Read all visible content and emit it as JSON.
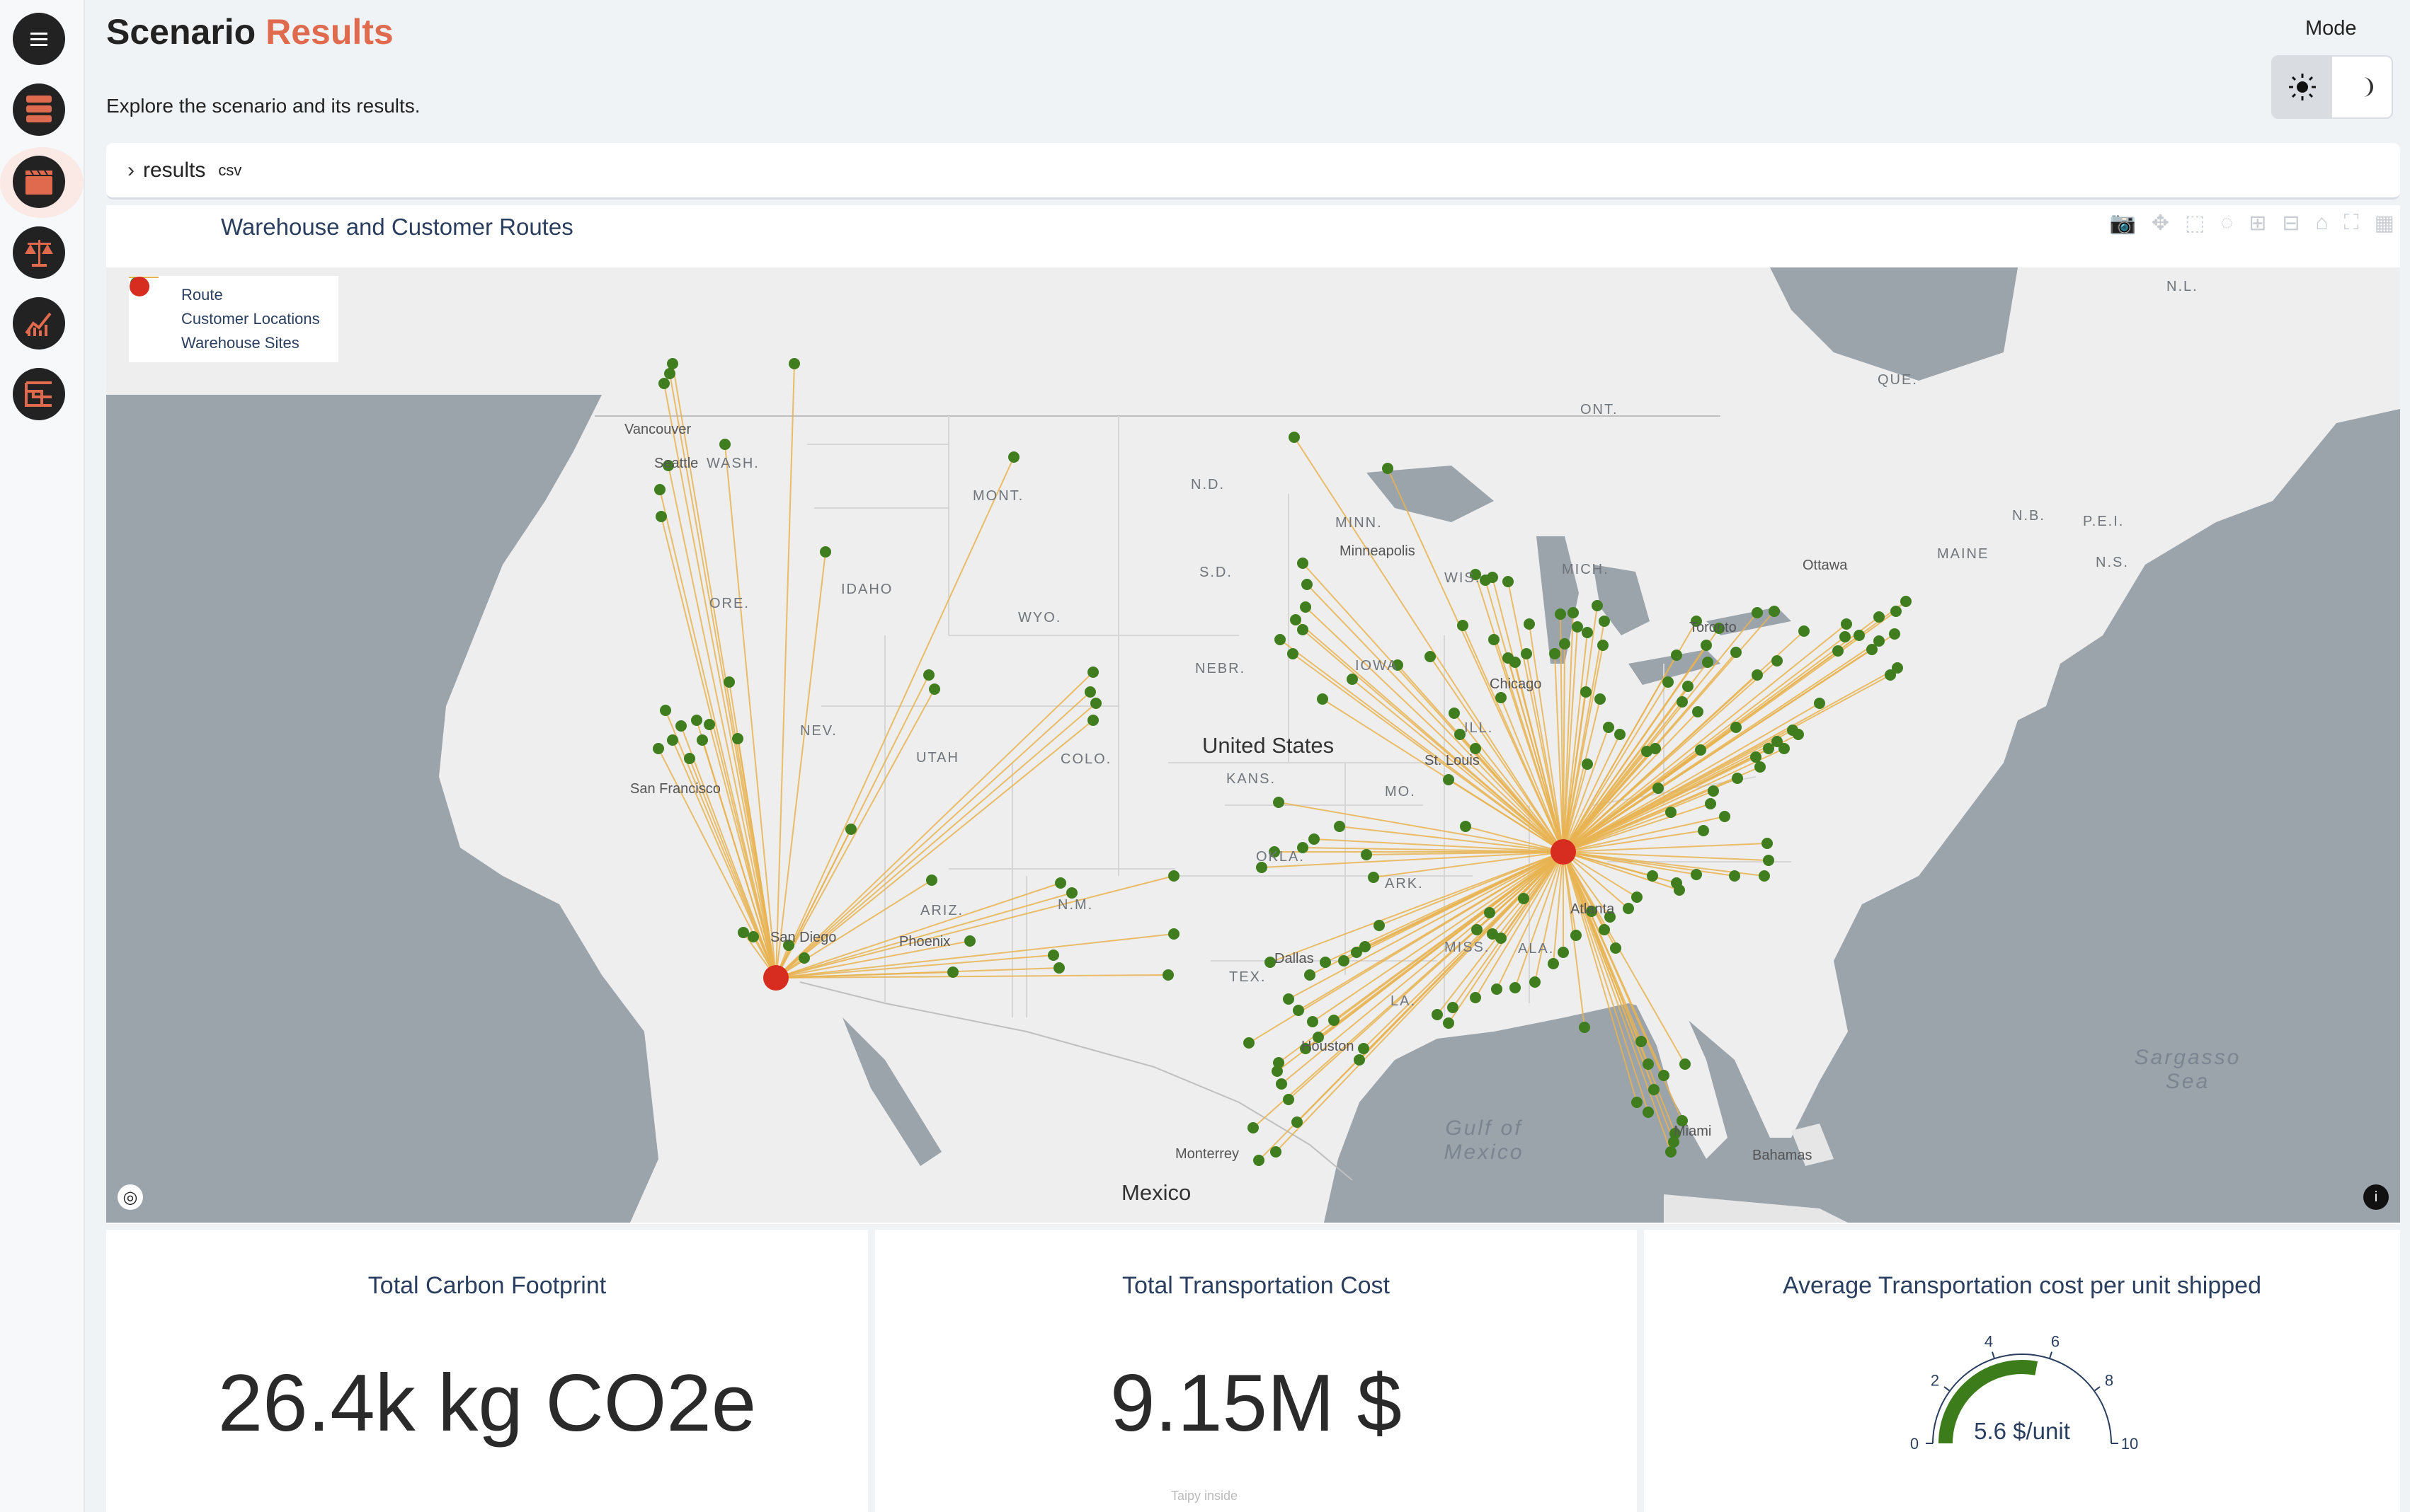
{
  "header": {
    "title_main": "Scenario",
    "title_accent": "Results",
    "subtitle": "Explore the scenario and its results.",
    "mode_label": "Mode"
  },
  "sidebar": {
    "items": [
      {
        "name": "menu-icon"
      },
      {
        "name": "data-stack-icon"
      },
      {
        "name": "scenario-clapper-icon"
      },
      {
        "name": "scales-icon"
      },
      {
        "name": "chart-icon"
      },
      {
        "name": "table-icon"
      }
    ]
  },
  "results_section": {
    "label": "results",
    "badge": "csv"
  },
  "map": {
    "title": "Warehouse and Customer Routes",
    "legend": [
      "Route",
      "Customer Locations",
      "Warehouse Sites"
    ],
    "colors": {
      "route": "#e7b350",
      "customer": "#3f7d1e",
      "warehouse": "#d62d20"
    },
    "labels": {
      "country": "United States",
      "mexico": "Mexico",
      "gulf": "Gulf of Mexico",
      "sargasso": "Sargasso Sea",
      "bahamas": "Bahamas",
      "ontario": "ONT.",
      "quebec": "QUE.",
      "nl": "N.L.",
      "nb": "N.B.",
      "ns": "N.S.",
      "pei": "P.E.I.",
      "maine": "MAINE",
      "vancouver": "Vancouver",
      "seattle": "Seattle",
      "sanfrancisco": "San Francisco",
      "sandiego": "San Diego",
      "phoenix": "Phoenix",
      "dallas": "Dallas",
      "houston": "Houston",
      "minneapolis": "Minneapolis",
      "chicago": "Chicago",
      "stlouis": "St. Louis",
      "toronto": "Toronto",
      "ottawa": "Ottawa",
      "atlanta": "Atlanta",
      "miami": "Miami",
      "monterrey": "Monterrey",
      "wash": "WASH.",
      "ore": "ORE.",
      "idaho": "IDAHO",
      "mont": "MONT.",
      "wyo": "WYO.",
      "nev": "NEV.",
      "utah": "UTAH",
      "colo": "COLO.",
      "ariz": "ARIZ.",
      "nm": "N.M.",
      "nd": "N.D.",
      "sd": "S.D.",
      "nebr": "NEBR.",
      "kans": "KANS.",
      "okla": "OKLA.",
      "tex": "TEX.",
      "minn": "MINN.",
      "iowa": "IOWA",
      "mo": "MO.",
      "ark": "ARK.",
      "la": "LA.",
      "wis": "WIS.",
      "mich": "MICH.",
      "ill": "ILL.",
      "miss": "MISS.",
      "ala": "ALA."
    }
  },
  "kpis": {
    "carbon": {
      "title": "Total Carbon Footprint",
      "value": "26.4k kg CO2e"
    },
    "cost": {
      "title": "Total Transportation Cost",
      "value": "9.15M $"
    },
    "avg": {
      "title": "Average Transportation cost per unit shipped",
      "value": "5.6 $/unit",
      "gauge": 5.6,
      "min": 0,
      "max": 10,
      "ticks": [
        "0",
        "2",
        "4",
        "6",
        "8",
        "10"
      ]
    }
  },
  "footer_note": "Taipy inside"
}
